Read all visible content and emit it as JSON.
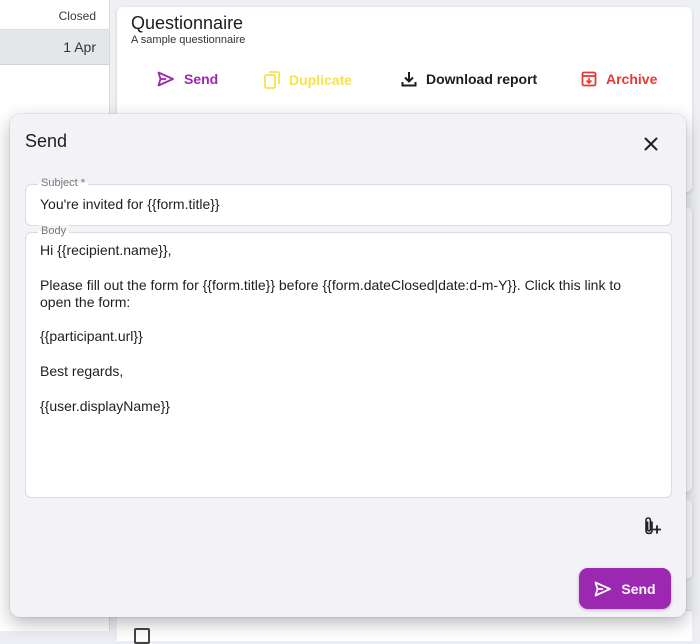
{
  "list": {
    "header_label": "Closed",
    "rows": [
      {
        "date": "1 Apr"
      }
    ]
  },
  "form": {
    "title": "Questionnaire",
    "subtitle": "A sample questionnaire",
    "actions": {
      "send": "Send",
      "duplicate": "Duplicate",
      "download_report": "Download report",
      "archive": "Archive"
    }
  },
  "dialog": {
    "title": "Send",
    "subject": {
      "label": "Subject *",
      "value": "You're invited for {{form.title}}"
    },
    "body": {
      "label": "Body",
      "paragraphs": [
        "Hi {{recipient.name}},",
        "Please fill out the form for {{form.title}} before {{form.dateClosed|date:d-m-Y}}. Click this link to open the form:",
        "{{participant.url}}",
        "Best regards,",
        "{{user.displayName}}"
      ]
    },
    "send_button": "Send"
  },
  "icons": {
    "send": "send-icon",
    "duplicate": "copy-icon",
    "download": "download-icon",
    "archive": "archive-icon",
    "close": "close-icon",
    "attach": "attach-file-icon"
  },
  "colors": {
    "accent": "#9c27b0",
    "duplicate": "#f7e34a",
    "archive": "#e53935"
  }
}
